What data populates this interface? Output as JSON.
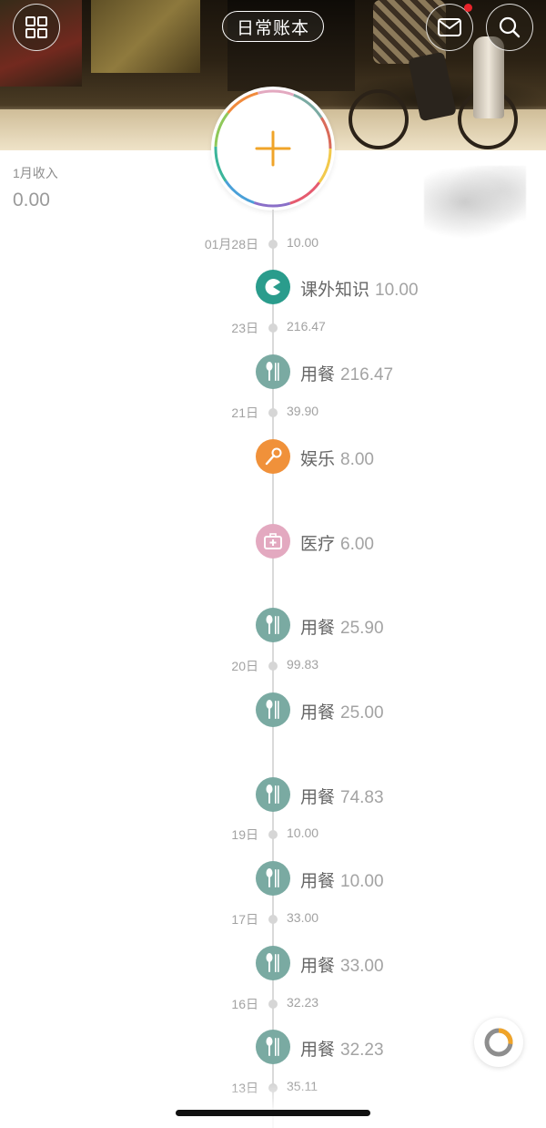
{
  "header": {
    "title": "日常账本",
    "menu_icon": "grid-icon",
    "mail_icon": "mail-icon",
    "search_icon": "search-icon",
    "notification_color": "#e8242b"
  },
  "add_button": {
    "icon": "plus-icon",
    "color": "#f0a429"
  },
  "income": {
    "label": "1月收入",
    "value": "0.00"
  },
  "timeline": {
    "days": [
      {
        "date": "01月28日",
        "total": "10.00"
      },
      {
        "date": "23日",
        "total": "216.47"
      },
      {
        "date": "21日",
        "total": "39.90"
      },
      {
        "date": "20日",
        "total": "99.83"
      },
      {
        "date": "19日",
        "total": "10.00"
      },
      {
        "date": "17日",
        "total": "33.00"
      },
      {
        "date": "16日",
        "total": "32.23"
      },
      {
        "date": "13日",
        "total": "35.11"
      }
    ],
    "entries": [
      {
        "category": "课外知识",
        "amount": "10.00",
        "icon": "pacman-icon",
        "color": "#2a9c8c"
      },
      {
        "category": "用餐",
        "amount": "216.47",
        "icon": "utensils-icon",
        "color": "#7aaaa2"
      },
      {
        "category": "娱乐",
        "amount": "8.00",
        "icon": "microphone-icon",
        "color": "#f0913a"
      },
      {
        "category": "医疗",
        "amount": "6.00",
        "icon": "medical-kit-icon",
        "color": "#e3a9c0"
      },
      {
        "category": "用餐",
        "amount": "25.90",
        "icon": "utensils-icon",
        "color": "#7aaaa2"
      },
      {
        "category": "用餐",
        "amount": "25.00",
        "icon": "utensils-icon",
        "color": "#7aaaa2"
      },
      {
        "category": "用餐",
        "amount": "74.83",
        "icon": "utensils-icon",
        "color": "#7aaaa2"
      },
      {
        "category": "用餐",
        "amount": "10.00",
        "icon": "utensils-icon",
        "color": "#7aaaa2"
      },
      {
        "category": "用餐",
        "amount": "33.00",
        "icon": "utensils-icon",
        "color": "#7aaaa2"
      },
      {
        "category": "用餐",
        "amount": "32.23",
        "icon": "utensils-icon",
        "color": "#7aaaa2"
      }
    ]
  },
  "chart_button": {
    "icon": "donut-chart-icon",
    "accent": "#f0a429"
  }
}
